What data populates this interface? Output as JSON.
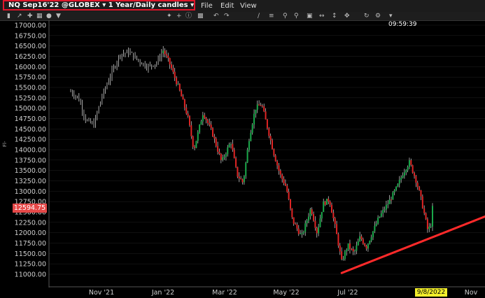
{
  "titlebar": {
    "title": "NQ Sep16'22 @GLOBEX ▾ 1 Year/Daily candles ▾",
    "menu": [
      "File",
      "Edit",
      "View"
    ]
  },
  "toolbar": {
    "icons": [
      "candles-icon",
      "trend-icon",
      "crosshair-icon",
      "chart-icon",
      "circle-icon",
      "dropdown-icon",
      "cursor-icon",
      "crosshair-plus-icon",
      "info-icon",
      "chart-type-icon",
      "undo-icon",
      "redo-icon",
      "drawing-icon",
      "fib-icon",
      "zoom-in-icon",
      "zoom-out-icon",
      "fit-icon",
      "fit-horizontal-icon",
      "fit-vertical-icon",
      "move-icon",
      "refresh-icon",
      "settings-icon",
      "more-icon"
    ]
  },
  "time_label": "09:59:39",
  "side_label": "File",
  "colors": {
    "up": "#1aa84a",
    "down": "#e02424",
    "trend": "#ff2a2a",
    "grid": "#222222",
    "axis": "#cfcfcf"
  },
  "chart_data": {
    "type": "candlestick",
    "instrument": "NQ Sep16'22",
    "ylim": [
      10900,
      17050
    ],
    "yticks": [
      "17000.00",
      "16750.00",
      "16500.00",
      "16250.00",
      "16000.00",
      "15750.00",
      "15500.00",
      "15250.00",
      "15000.00",
      "14750.00",
      "14500.00",
      "14250.00",
      "14000.00",
      "13750.00",
      "13500.00",
      "13250.00",
      "13000.00",
      "12750.00",
      "12500.00",
      "12250.00",
      "12000.00",
      "11750.00",
      "11500.00",
      "11250.00",
      "11000.00"
    ],
    "xticks": [
      {
        "label": "Nov '21",
        "month_index": 1
      },
      {
        "label": "Jan '22",
        "month_index": 3
      },
      {
        "label": "Mar '22",
        "month_index": 5
      },
      {
        "label": "May '22",
        "month_index": 7
      },
      {
        "label": "Jul '22",
        "month_index": 9
      },
      {
        "label": "Nov",
        "month_index": 13
      }
    ],
    "x_start_month": "2021-10",
    "x_end_month": "2022-11",
    "last_price": "12594.75",
    "current_date": "9/8/2022",
    "price_path": [
      {
        "m": 0.0,
        "p": 15400
      },
      {
        "m": 0.25,
        "p": 15250
      },
      {
        "m": 0.5,
        "p": 14700
      },
      {
        "m": 0.75,
        "p": 14600
      },
      {
        "m": 1.0,
        "p": 15250
      },
      {
        "m": 1.3,
        "p": 15800
      },
      {
        "m": 1.6,
        "p": 16300
      },
      {
        "m": 1.9,
        "p": 16350
      },
      {
        "m": 2.2,
        "p": 16150
      },
      {
        "m": 2.5,
        "p": 16000
      },
      {
        "m": 2.8,
        "p": 16100
      },
      {
        "m": 3.0,
        "p": 16400
      },
      {
        "m": 3.2,
        "p": 16100
      },
      {
        "m": 3.5,
        "p": 15500
      },
      {
        "m": 3.8,
        "p": 14800
      },
      {
        "m": 4.0,
        "p": 14000
      },
      {
        "m": 4.3,
        "p": 14900
      },
      {
        "m": 4.6,
        "p": 14400
      },
      {
        "m": 4.9,
        "p": 13700
      },
      {
        "m": 5.2,
        "p": 14200
      },
      {
        "m": 5.4,
        "p": 13400
      },
      {
        "m": 5.6,
        "p": 13200
      },
      {
        "m": 5.8,
        "p": 14300
      },
      {
        "m": 6.0,
        "p": 15000
      },
      {
        "m": 6.2,
        "p": 15100
      },
      {
        "m": 6.4,
        "p": 14500
      },
      {
        "m": 6.6,
        "p": 13900
      },
      {
        "m": 6.8,
        "p": 13400
      },
      {
        "m": 7.0,
        "p": 13100
      },
      {
        "m": 7.2,
        "p": 12300
      },
      {
        "m": 7.5,
        "p": 11900
      },
      {
        "m": 7.8,
        "p": 12600
      },
      {
        "m": 8.0,
        "p": 12000
      },
      {
        "m": 8.2,
        "p": 12700
      },
      {
        "m": 8.4,
        "p": 12800
      },
      {
        "m": 8.6,
        "p": 12100
      },
      {
        "m": 8.8,
        "p": 11300
      },
      {
        "m": 9.0,
        "p": 11700
      },
      {
        "m": 9.2,
        "p": 11500
      },
      {
        "m": 9.4,
        "p": 11900
      },
      {
        "m": 9.6,
        "p": 11650
      },
      {
        "m": 9.8,
        "p": 12000
      },
      {
        "m": 10.0,
        "p": 12350
      },
      {
        "m": 10.3,
        "p": 12700
      },
      {
        "m": 10.6,
        "p": 13100
      },
      {
        "m": 10.8,
        "p": 13450
      },
      {
        "m": 11.0,
        "p": 13700
      },
      {
        "m": 11.2,
        "p": 13300
      },
      {
        "m": 11.35,
        "p": 12900
      },
      {
        "m": 11.5,
        "p": 12400
      },
      {
        "m": 11.6,
        "p": 12050
      },
      {
        "m": 11.7,
        "p": 12200
      },
      {
        "m": 11.75,
        "p": 12594
      }
    ],
    "candle_count": 220,
    "trend_line": {
      "start": {
        "m": 8.8,
        "p": 11030
      },
      "end": {
        "m": 14.0,
        "p": 12550
      }
    }
  },
  "side_tag": "Fl-"
}
